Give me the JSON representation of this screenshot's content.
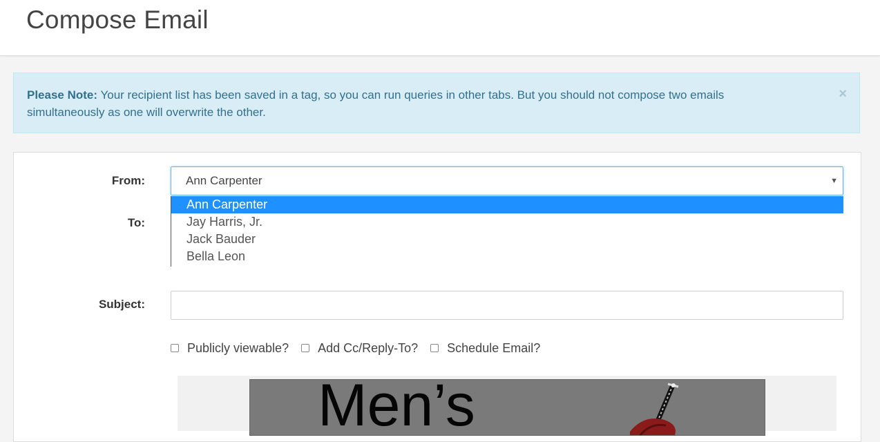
{
  "header": {
    "title": "Compose Email"
  },
  "alert": {
    "strong": "Please Note:",
    "message": " Your recipient list has been saved in a tag, so you can run queries in other tabs. But you should not compose two emails simultaneously as one will overwrite the other.",
    "close": "×"
  },
  "form": {
    "from_label": "From:",
    "to_label": "To:",
    "subject_label": "Subject:",
    "from_selected": "Ann Carpenter",
    "from_options": [
      "Ann Carpenter",
      "Jay Harris, Jr.",
      "Jack Bauder",
      "Bella Leon"
    ],
    "subject_value": "",
    "checkboxes": [
      "Publicly viewable?",
      "Add Cc/Reply-To?",
      "Schedule Email?"
    ]
  },
  "preview": {
    "banner_text": "Men’s"
  },
  "colors": {
    "accent": "#1e90ff",
    "alert_bg": "#d9edf7",
    "alert_text": "#31708f"
  }
}
